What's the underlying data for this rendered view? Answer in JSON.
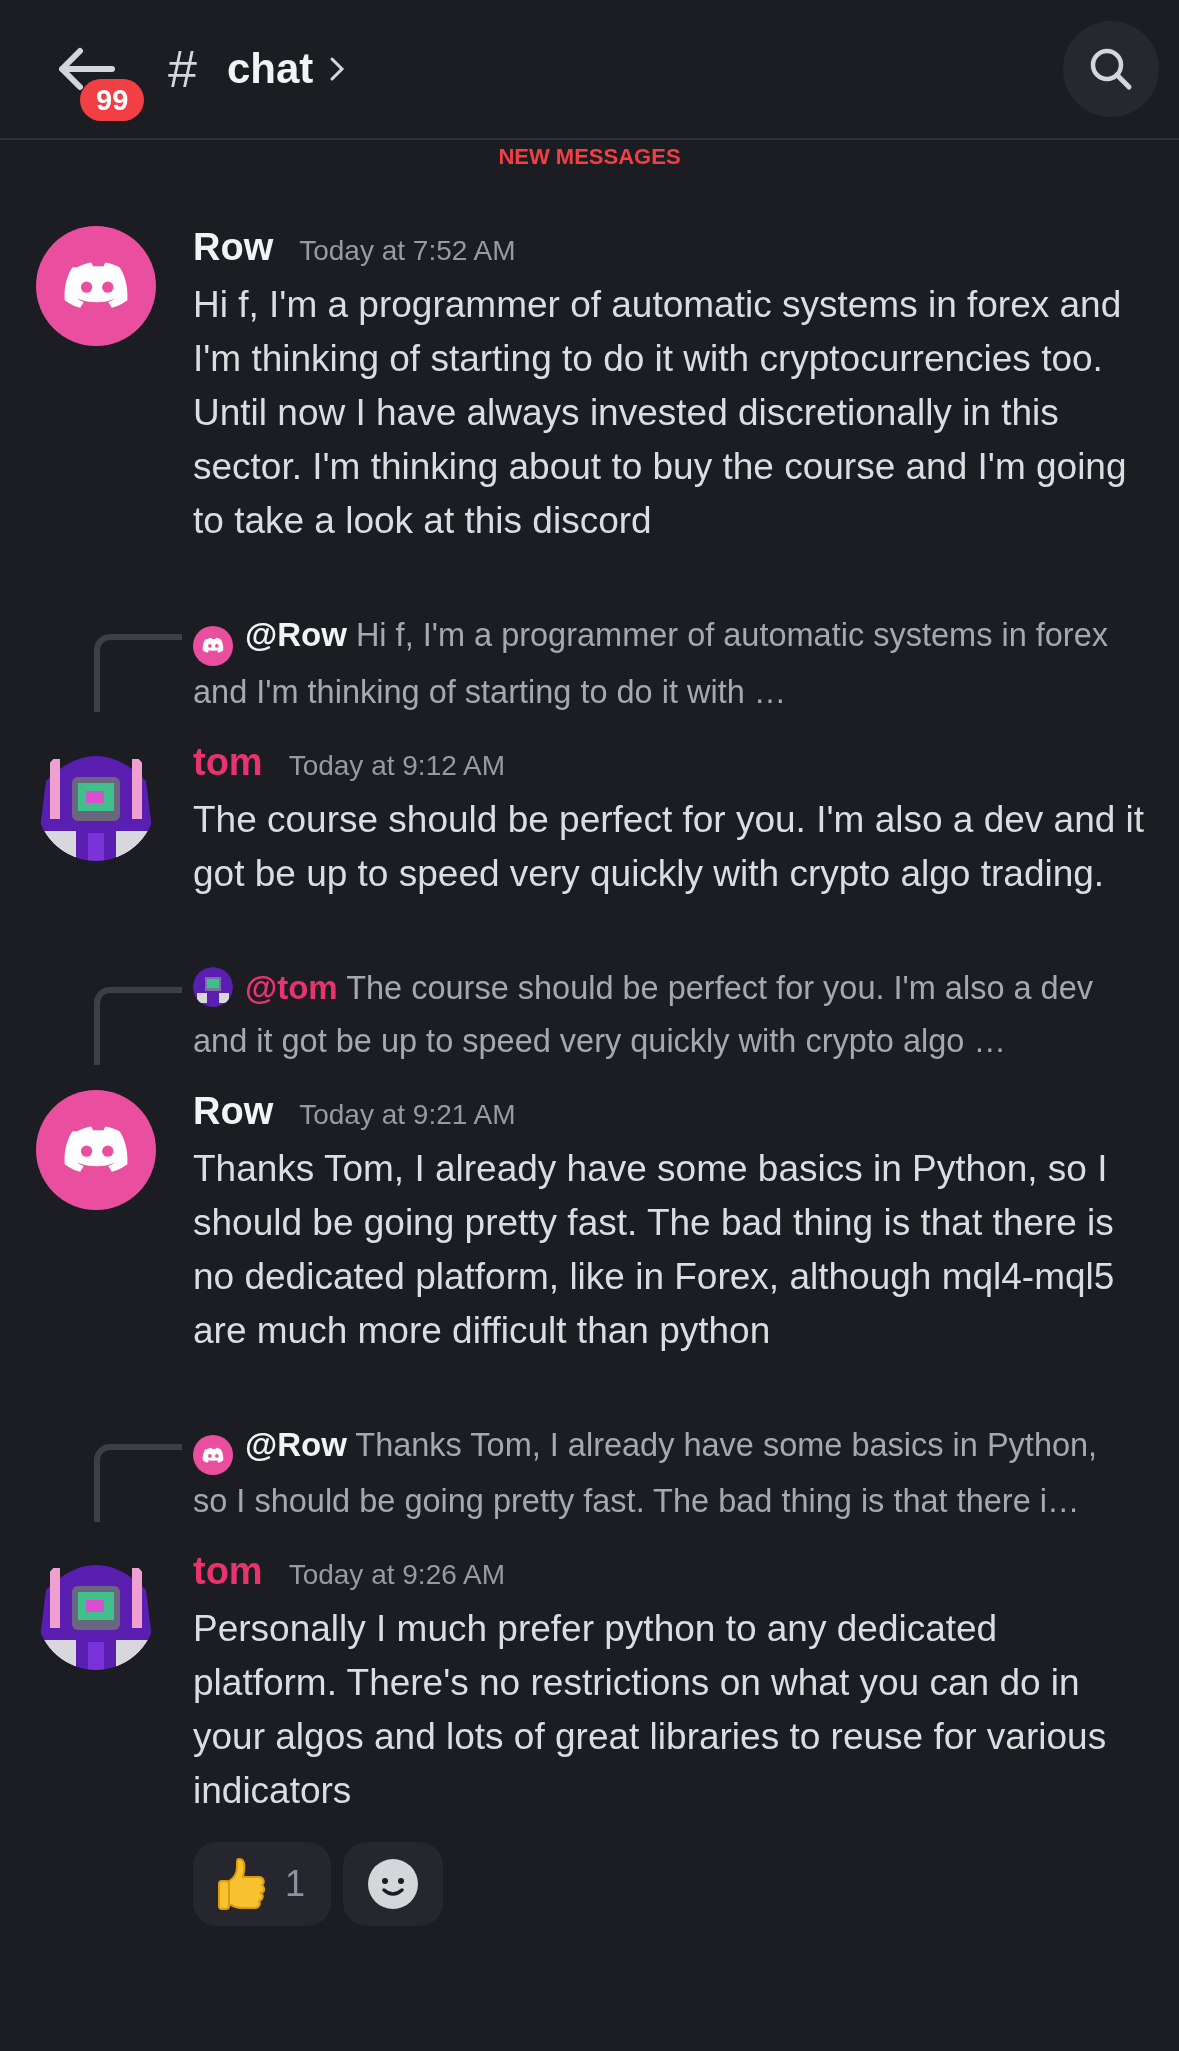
{
  "header": {
    "badge": "99",
    "channel_symbol": "#",
    "channel": "chat"
  },
  "divider_label": "NEW MESSAGES",
  "messages": [
    {
      "author": "Row",
      "avatar": {
        "kind": "logo"
      },
      "color": "#f2f3f5",
      "time": "Today at 7:52 AM",
      "text": "Hi f, I'm a programmer of automatic systems in forex and I'm thinking of starting to do it with cryptocurrencies too. Until now I have always invested discretionally in this sector. I'm thinking about to buy the course and I'm going to take a look at this discord"
    },
    {
      "reply": {
        "avatar": {
          "kind": "logo"
        },
        "author": "@Row",
        "color": "#f2f3f5",
        "text": "Hi f, I'm a programmer of automatic systems in forex and I'm thinking of starting to do it with …"
      },
      "author": "tom",
      "color": "#e8336e",
      "time": "Today at 9:12 AM",
      "text": "The course should be perfect for you. I'm also a dev and it got be up to speed very quickly with crypto algo trading."
    },
    {
      "reply": {
        "author": "@tom",
        "color": "#e8336e",
        "text": "The course should be perfect for you. I'm also a dev and it got be up to speed very quickly with crypto algo …"
      },
      "author": "Row",
      "avatar": {
        "kind": "logo"
      },
      "color": "#f2f3f5",
      "time": "Today at 9:21 AM",
      "text": "Thanks Tom, I already have some basics in Python, so I should be going pretty fast. The bad thing is that there is no dedicated platform, like in Forex, although mql4-mql5 are much more difficult than python"
    },
    {
      "reply": {
        "avatar": {
          "kind": "logo"
        },
        "author": "@Row",
        "color": "#f2f3f5",
        "text": "Thanks Tom, I already have some basics in Python, so I should be going pretty fast. The bad thing is that there i…"
      },
      "author": "tom",
      "color": "#e8336e",
      "time": "Today at 9:26 AM",
      "text": "Personally I much prefer python to any dedicated platform. There's no restrictions on what you can do in your algos and lots of great libraries to reuse for various indicators",
      "reactions": [
        {
          "kind": "thumbs-up",
          "count": "1"
        }
      ]
    }
  ]
}
